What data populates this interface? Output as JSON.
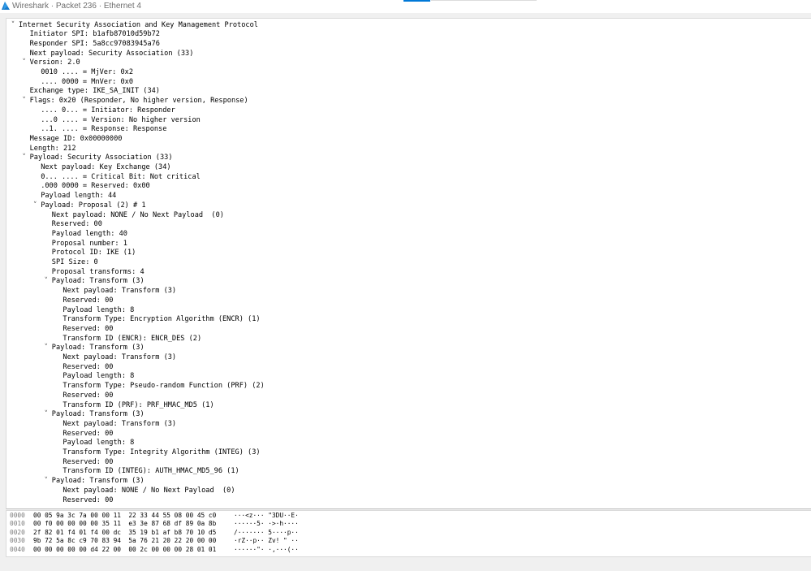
{
  "window": {
    "title": "Wireshark · Packet 236 · Ethernet 4"
  },
  "icons": {
    "app": "wireshark-fin-icon",
    "expanded": "chevron-down-icon"
  },
  "colors": {
    "accent": "#0078d7",
    "pane_background": "#ffffff",
    "window_background": "#f0f0f0"
  },
  "tree": [
    {
      "level": 0,
      "expanded": true,
      "text": "Internet Security Association and Key Management Protocol"
    },
    {
      "level": 1,
      "text": "Initiator SPI: b1afb87010d59b72"
    },
    {
      "level": 1,
      "text": "Responder SPI: 5a8cc97083945a76"
    },
    {
      "level": 1,
      "text": "Next payload: Security Association (33)"
    },
    {
      "level": 1,
      "expanded": true,
      "text": "Version: 2.0"
    },
    {
      "level": 2,
      "text": "0010 .... = MjVer: 0x2"
    },
    {
      "level": 2,
      "text": ".... 0000 = MnVer: 0x0"
    },
    {
      "level": 1,
      "text": "Exchange type: IKE_SA_INIT (34)"
    },
    {
      "level": 1,
      "expanded": true,
      "text": "Flags: 0x20 (Responder, No higher version, Response)"
    },
    {
      "level": 2,
      "text": ".... 0... = Initiator: Responder"
    },
    {
      "level": 2,
      "text": "...0 .... = Version: No higher version"
    },
    {
      "level": 2,
      "text": "..1. .... = Response: Response"
    },
    {
      "level": 1,
      "text": "Message ID: 0x00000000"
    },
    {
      "level": 1,
      "text": "Length: 212"
    },
    {
      "level": 1,
      "expanded": true,
      "text": "Payload: Security Association (33)"
    },
    {
      "level": 2,
      "text": "Next payload: Key Exchange (34)"
    },
    {
      "level": 2,
      "text": "0... .... = Critical Bit: Not critical"
    },
    {
      "level": 2,
      "text": ".000 0000 = Reserved: 0x00"
    },
    {
      "level": 2,
      "text": "Payload length: 44"
    },
    {
      "level": 2,
      "expanded": true,
      "text": "Payload: Proposal (2) # 1"
    },
    {
      "level": 3,
      "text": "Next payload: NONE / No Next Payload  (0)"
    },
    {
      "level": 3,
      "text": "Reserved: 00"
    },
    {
      "level": 3,
      "text": "Payload length: 40"
    },
    {
      "level": 3,
      "text": "Proposal number: 1"
    },
    {
      "level": 3,
      "text": "Protocol ID: IKE (1)"
    },
    {
      "level": 3,
      "text": "SPI Size: 0"
    },
    {
      "level": 3,
      "text": "Proposal transforms: 4"
    },
    {
      "level": 3,
      "expanded": true,
      "text": "Payload: Transform (3)"
    },
    {
      "level": 4,
      "text": "Next payload: Transform (3)"
    },
    {
      "level": 4,
      "text": "Reserved: 00"
    },
    {
      "level": 4,
      "text": "Payload length: 8"
    },
    {
      "level": 4,
      "text": "Transform Type: Encryption Algorithm (ENCR) (1)"
    },
    {
      "level": 4,
      "text": "Reserved: 00"
    },
    {
      "level": 4,
      "text": "Transform ID (ENCR): ENCR_DES (2)"
    },
    {
      "level": 3,
      "expanded": true,
      "text": "Payload: Transform (3)"
    },
    {
      "level": 4,
      "text": "Next payload: Transform (3)"
    },
    {
      "level": 4,
      "text": "Reserved: 00"
    },
    {
      "level": 4,
      "text": "Payload length: 8"
    },
    {
      "level": 4,
      "text": "Transform Type: Pseudo-random Function (PRF) (2)"
    },
    {
      "level": 4,
      "text": "Reserved: 00"
    },
    {
      "level": 4,
      "text": "Transform ID (PRF): PRF_HMAC_MD5 (1)"
    },
    {
      "level": 3,
      "expanded": true,
      "text": "Payload: Transform (3)"
    },
    {
      "level": 4,
      "text": "Next payload: Transform (3)"
    },
    {
      "level": 4,
      "text": "Reserved: 00"
    },
    {
      "level": 4,
      "text": "Payload length: 8"
    },
    {
      "level": 4,
      "text": "Transform Type: Integrity Algorithm (INTEG) (3)"
    },
    {
      "level": 4,
      "text": "Reserved: 00"
    },
    {
      "level": 4,
      "text": "Transform ID (INTEG): AUTH_HMAC_MD5_96 (1)"
    },
    {
      "level": 3,
      "expanded": true,
      "text": "Payload: Transform (3)"
    },
    {
      "level": 4,
      "text": "Next payload: NONE / No Next Payload  (0)"
    },
    {
      "level": 4,
      "text": "Reserved: 00"
    }
  ],
  "hex": [
    {
      "offset": "0000",
      "bytes": "00 05 9a 3c 7a 00 00 11  22 33 44 55 08 00 45 c0",
      "ascii": "···<z··· \"3DU··E·"
    },
    {
      "offset": "0010",
      "bytes": "00 f0 00 00 00 00 35 11  e3 3e 87 68 df 89 0a 8b",
      "ascii": "······5· ·>·h····"
    },
    {
      "offset": "0020",
      "bytes": "2f 82 01 f4 01 f4 00 dc  35 19 b1 af b8 70 10 d5",
      "ascii": "/······· 5····p··"
    },
    {
      "offset": "0030",
      "bytes": "9b 72 5a 8c c9 70 83 94  5a 76 21 20 22 20 00 00",
      "ascii": "·rZ··p·· Zv! \" ··"
    },
    {
      "offset": "0040",
      "bytes": "00 00 00 00 00 d4 22 00  00 2c 00 00 00 28 01 01",
      "ascii": "······\"· ·,···(··"
    }
  ]
}
